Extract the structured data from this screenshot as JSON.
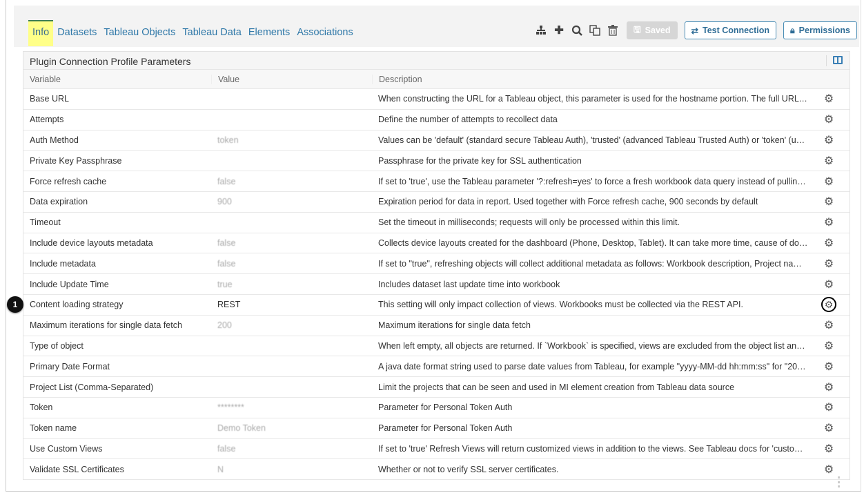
{
  "tabs": [
    {
      "label": "Info"
    },
    {
      "label": "Datasets"
    },
    {
      "label": "Tableau Objects"
    },
    {
      "label": "Tableau Data"
    },
    {
      "label": "Elements"
    },
    {
      "label": "Associations"
    }
  ],
  "toolbar": {
    "saved_label": "Saved",
    "test_connection_label": "Test Connection",
    "permissions_label": "Permissions"
  },
  "panel": {
    "title": "Plugin Connection Profile Parameters",
    "columns": {
      "variable": "Variable",
      "value": "Value",
      "description": "Description"
    }
  },
  "callout": "1",
  "rows": [
    {
      "variable": "Base URL",
      "value": "",
      "description": "When constructing the URL for a Tableau object, this parameter is used for the hostname portion. The full URL is c..."
    },
    {
      "variable": "Attempts",
      "value": "",
      "description": "Define the number of attempts to recollect data"
    },
    {
      "variable": "Auth Method",
      "value": "token",
      "description": "Values can be 'default' (standard secure Tableau Auth), 'trusted' (advanced Tableau Trusted Auth) or 'token' (use P..."
    },
    {
      "variable": "Private Key Passphrase",
      "value": "",
      "description": "Passphrase for the private key for SSL authentication"
    },
    {
      "variable": "Force refresh cache",
      "value": "false",
      "description": "If set to 'true', use the Tableau parameter '?:refresh=yes' to force a fresh workbook data query instead of pulling the..."
    },
    {
      "variable": "Data expiration",
      "value": "900",
      "description": "Expiration period for data in report. Used together with Force refresh cache, 900 seconds by default"
    },
    {
      "variable": "Timeout",
      "value": "",
      "description": "Set the timeout in milliseconds; requests will only be processed within this limit."
    },
    {
      "variable": "Include device layouts metadata",
      "value": "false",
      "description": "Collects device layouts created for the dashboard (Phone, Desktop, Tablet). It can take more time, cause of downlo..."
    },
    {
      "variable": "Include metadata",
      "value": "false",
      "description": "If set to \"true\", refreshing objects will collect additional metadata as follows: Workbook description, Project name, O..."
    },
    {
      "variable": "Include Update Time",
      "value": "true",
      "description": "Includes dataset last update time into workbook"
    },
    {
      "variable": "Content loading strategy",
      "value": "REST",
      "description": "This setting will only impact collection of views. Workbooks must be collected via the REST API."
    },
    {
      "variable": "Maximum iterations for single data fetch",
      "value": "200",
      "description": "Maximum iterations for single data fetch"
    },
    {
      "variable": "Type of object",
      "value": "",
      "description": "When left empty, all objects are returned. If `Workbook` is specified, views are excluded from the object list and onl..."
    },
    {
      "variable": "Primary Date Format",
      "value": "",
      "description": "A java date format string used to parse date values from Tableau, for example \"yyyy-MM-dd hh:mm:ss\" for \"2015-0..."
    },
    {
      "variable": "Project List (Comma-Separated)",
      "value": "",
      "description": "Limit the projects that can be seen and used in MI element creation from Tableau data source"
    },
    {
      "variable": "Token",
      "value": "********",
      "description": "Parameter for Personal Token Auth"
    },
    {
      "variable": "Token name",
      "value": "Demo Token",
      "description": "Parameter for Personal Token Auth"
    },
    {
      "variable": "Use Custom Views",
      "value": "false",
      "description": "If set to 'true' Refresh Views will return customized views in addition to the views. See Tableau docs for 'custom vie..."
    },
    {
      "variable": "Validate SSL Certificates",
      "value": "N",
      "description": "Whether or not to verify SSL server certificates."
    }
  ]
}
